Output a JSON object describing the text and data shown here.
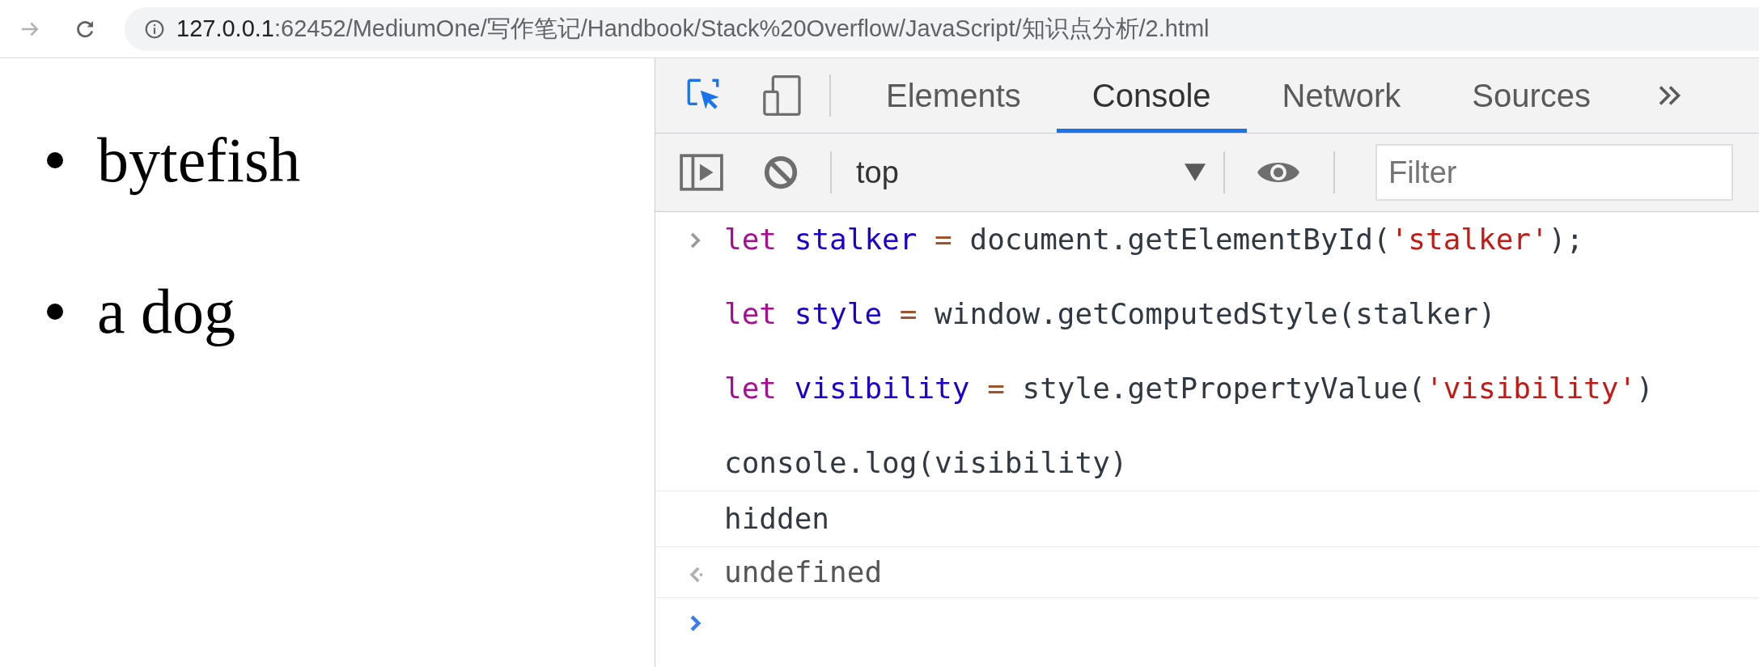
{
  "address_bar": {
    "host": "127.0.0.1",
    "path": ":62452/MediumOne/写作笔记/Handbook/Stack%20Overflow/JavaScript/知识点分析/2.html"
  },
  "page": {
    "list_items": [
      "bytefish",
      "a dog"
    ]
  },
  "devtools": {
    "tabs": [
      {
        "label": "Elements",
        "selected": false
      },
      {
        "label": "Console",
        "selected": true
      },
      {
        "label": "Network",
        "selected": false
      },
      {
        "label": "Sources",
        "selected": false
      }
    ],
    "context": "top",
    "filter": {
      "placeholder": "Filter"
    }
  },
  "console": {
    "entries": [
      {
        "kind": "input",
        "lines": [
          [
            {
              "text": "let ",
              "kind": "keyword"
            },
            {
              "text": "stalker ",
              "kind": "variable"
            },
            {
              "text": "=",
              "kind": "operator"
            },
            {
              "text": " document.getElementById(",
              "kind": "plain"
            },
            {
              "text": "'stalker'",
              "kind": "string"
            },
            {
              "text": ");",
              "kind": "plain"
            }
          ],
          [
            {
              "text": "let ",
              "kind": "keyword"
            },
            {
              "text": "style ",
              "kind": "variable"
            },
            {
              "text": "=",
              "kind": "operator"
            },
            {
              "text": " window.getComputedStyle(stalker)",
              "kind": "plain"
            }
          ],
          [
            {
              "text": "let ",
              "kind": "keyword"
            },
            {
              "text": "visibility ",
              "kind": "variable"
            },
            {
              "text": "=",
              "kind": "operator"
            },
            {
              "text": " style.getPropertyValue(",
              "kind": "plain"
            },
            {
              "text": "'visibility'",
              "kind": "string"
            },
            {
              "text": ")",
              "kind": "plain"
            }
          ],
          [
            {
              "text": "console.log(visibility)",
              "kind": "plain"
            }
          ]
        ]
      },
      {
        "kind": "log",
        "text": "hidden"
      },
      {
        "kind": "result",
        "text": "undefined"
      },
      {
        "kind": "prompt"
      }
    ]
  }
}
